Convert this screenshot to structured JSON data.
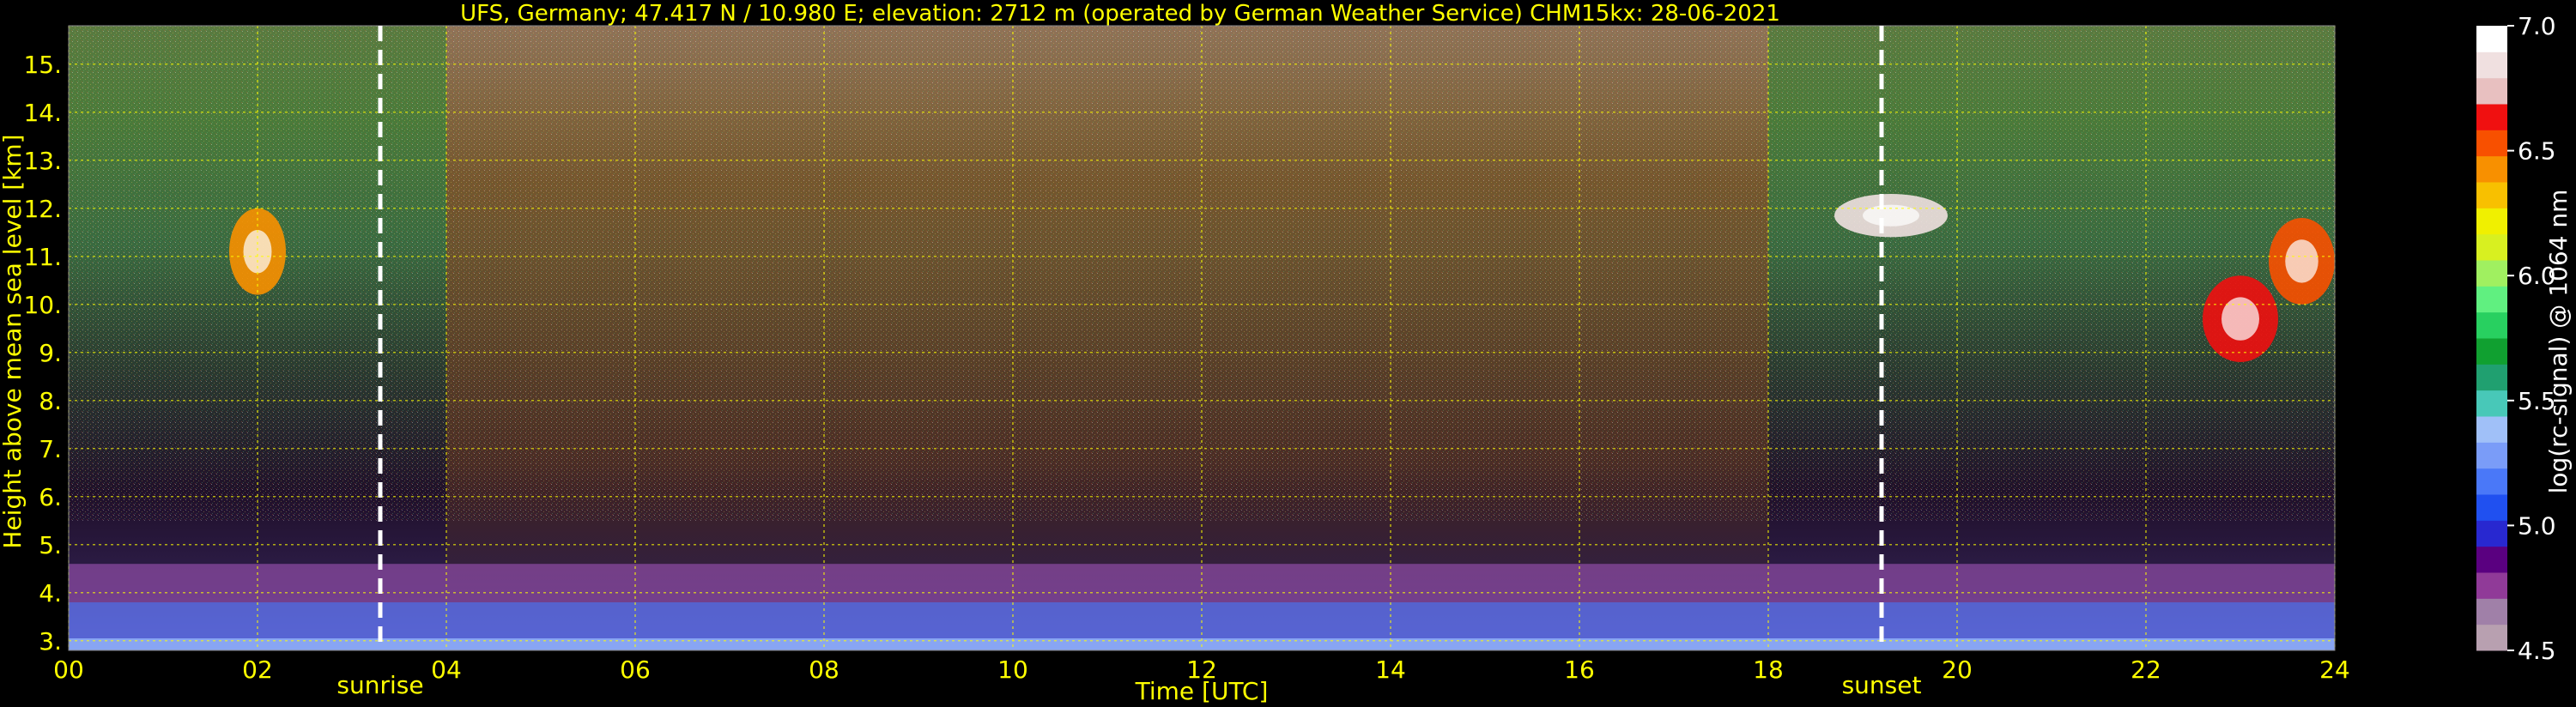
{
  "chart_data": {
    "type": "heatmap",
    "title": "UFS, Germany; 47.417 N / 10.980 E; elevation: 2712 m  (operated by German Weather Service)    CHM15kx: 28-06-2021",
    "xlabel": "Time [UTC]",
    "ylabel": "Height above mean sea level [km]",
    "xlim": [
      0,
      24
    ],
    "ylim": [
      2.8,
      15.8
    ],
    "x_ticks": [
      "00",
      "02",
      "04",
      "06",
      "08",
      "10",
      "12",
      "14",
      "16",
      "18",
      "20",
      "22",
      "24"
    ],
    "y_ticks": [
      "3.",
      "4.",
      "5.",
      "6.",
      "7.",
      "8.",
      "9.",
      "10.",
      "11.",
      "12.",
      "13.",
      "14.",
      "15."
    ],
    "grid": true,
    "events": [
      {
        "label": "sunrise",
        "time": 3.3
      },
      {
        "label": "sunset",
        "time": 19.2
      }
    ],
    "colorbar": {
      "label": "log(rc-signal) @ 1064 nm",
      "range": [
        4.5,
        7.0
      ],
      "ticks": [
        "4.5",
        "5.0",
        "5.5",
        "6.0",
        "6.5",
        "7.0"
      ],
      "colors": [
        "#b8a0b0",
        "#a080a8",
        "#903a98",
        "#5a0080",
        "#2828d0",
        "#2050f0",
        "#4a78f8",
        "#7a9cf8",
        "#a0c0f8",
        "#48c8b8",
        "#20a070",
        "#10a030",
        "#28d060",
        "#60f080",
        "#a0f060",
        "#d8f020",
        "#f0f000",
        "#f8c000",
        "#f89000",
        "#f85000",
        "#f01010",
        "#e8c0c0",
        "#f0e0e0",
        "#ffffff"
      ]
    },
    "clouds": [
      {
        "time": [
          1.7,
          2.3
        ],
        "height": [
          10.2,
          12.0
        ],
        "level": 6.4
      },
      {
        "time": [
          18.7,
          19.9
        ],
        "height": [
          11.4,
          12.3
        ],
        "level": 6.8
      },
      {
        "time": [
          22.6,
          23.4
        ],
        "height": [
          8.8,
          10.6
        ],
        "level": 6.6
      },
      {
        "time": [
          23.3,
          24.0
        ],
        "height": [
          10.0,
          11.8
        ],
        "level": 6.5
      }
    ]
  }
}
